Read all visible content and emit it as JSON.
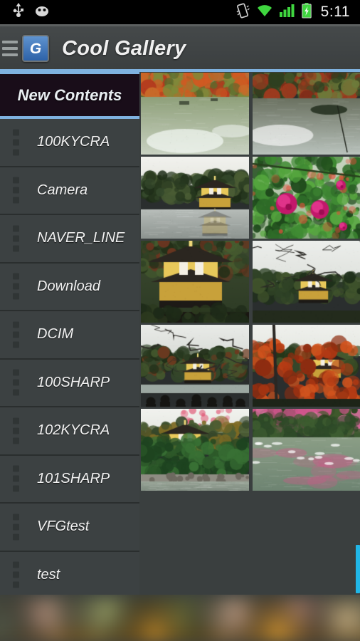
{
  "status_bar": {
    "icons_left": [
      "usb-icon",
      "android-head-icon"
    ],
    "icons_right": [
      "vibrate-icon",
      "wifi-icon",
      "signal-icon",
      "battery-charging-icon"
    ],
    "time": "5:11",
    "accent_green": "#3fd63f"
  },
  "action_bar": {
    "menu_icon": "hamburger-icon",
    "app_icon_letter": "G",
    "title": "Cool Gallery",
    "accent_blue": "#7fb2e0"
  },
  "sidebar": {
    "header": "New Contents",
    "header_bg": "#190d19",
    "items": [
      {
        "label": "100KYCRA"
      },
      {
        "label": "Camera"
      },
      {
        "label": "NAVER_LINE"
      },
      {
        "label": "Download"
      },
      {
        "label": "DCIM"
      },
      {
        "label": "100SHARP"
      },
      {
        "label": "102KYCRA"
      },
      {
        "label": "101SHARP"
      },
      {
        "label": "VFGtest"
      },
      {
        "label": "test"
      }
    ]
  },
  "gallery": {
    "columns": 2,
    "thumbnails": [
      {
        "name": "pond-autumn-reflection-1",
        "scene": "pond_autumn"
      },
      {
        "name": "pond-autumn-reflection-2",
        "scene": "pond_autumn_dark"
      },
      {
        "name": "golden-pavilion-across-pond",
        "scene": "pavilion_pond"
      },
      {
        "name": "pink-camellia-flowers",
        "scene": "camellia"
      },
      {
        "name": "golden-pavilion-closeup",
        "scene": "pavilion_close"
      },
      {
        "name": "golden-pavilion-bare-branches",
        "scene": "pavilion_branches"
      },
      {
        "name": "golden-pavilion-with-visitors",
        "scene": "pavilion_crowd"
      },
      {
        "name": "golden-pavilion-autumn-maple",
        "scene": "pavilion_maple"
      },
      {
        "name": "golden-pavilion-garden-pines",
        "scene": "pavilion_pines"
      },
      {
        "name": "pond-pink-maple-reflection",
        "scene": "pond_pink"
      }
    ],
    "scrollbar_color": "#20b7e8"
  }
}
